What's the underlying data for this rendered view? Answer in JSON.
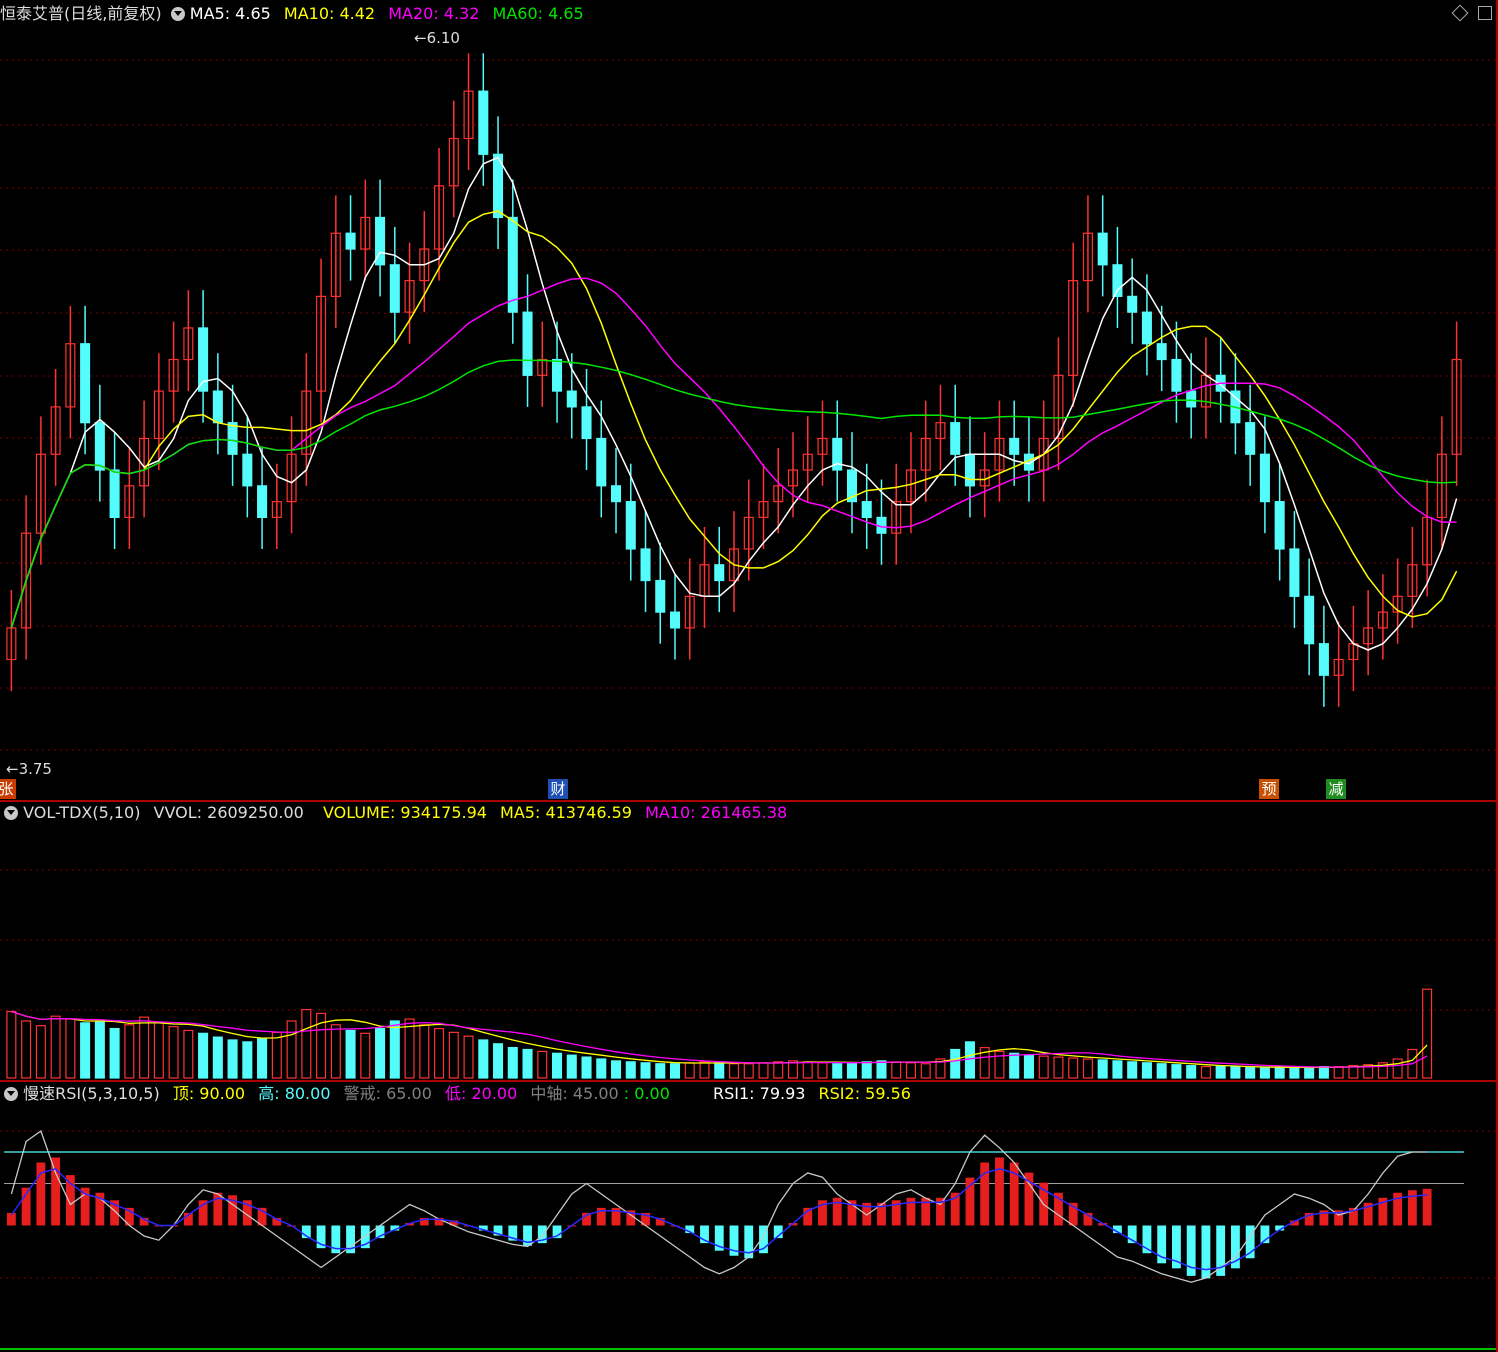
{
  "header_main": {
    "title": "恒泰艾普(日线,前复权)",
    "ma5": "MA5: 4.65",
    "ma10": "MA10: 4.42",
    "ma20": "MA20: 4.32",
    "ma60": "MA60: 4.65"
  },
  "price_labels": {
    "high": "6.10",
    "low": "3.75"
  },
  "markers": {
    "zhang": "张",
    "cai": "财",
    "yu": "预",
    "jian": "减"
  },
  "header_vol": {
    "name": "VOL-TDX(5,10)",
    "vvol": "VVOL: 2609250.00",
    "volume": "VOLUME: 934175.94",
    "ma5": "MA5: 413746.59",
    "ma10": "MA10: 261465.38"
  },
  "header_rsi": {
    "name": "慢速RSI(5,3,10,5)",
    "top": "顶: 90.00",
    "high": "高: 80.00",
    "warn": "警戒: 65.00",
    "low": "低: 20.00",
    "axis": "中轴: 45.00",
    "zero": ": 0.00",
    "rsi1": "RSI1: 79.93",
    "rsi2": "RSI2: 59.56"
  },
  "colors": {
    "up": "#ff3232",
    "down": "#54fcfc",
    "ma5": "#ffffff",
    "ma10": "#ffff00",
    "ma20": "#ff00ff",
    "ma60": "#00e600",
    "grid": "#7a0000",
    "frame": "#aa0000"
  },
  "chart_data": {
    "type": "candlestick",
    "price_range": [
      3.75,
      6.1
    ],
    "closes": [
      4.2,
      4.5,
      4.75,
      4.9,
      5.1,
      4.85,
      4.7,
      4.55,
      4.65,
      4.8,
      4.95,
      5.05,
      5.15,
      4.95,
      4.85,
      4.75,
      4.65,
      4.55,
      4.6,
      4.75,
      4.95,
      5.25,
      5.45,
      5.4,
      5.5,
      5.35,
      5.2,
      5.3,
      5.4,
      5.6,
      5.75,
      5.9,
      5.7,
      5.5,
      5.2,
      5.0,
      5.05,
      4.95,
      4.9,
      4.8,
      4.65,
      4.6,
      4.45,
      4.35,
      4.25,
      4.2,
      4.3,
      4.4,
      4.35,
      4.45,
      4.55,
      4.6,
      4.65,
      4.7,
      4.75,
      4.8,
      4.7,
      4.6,
      4.55,
      4.5,
      4.6,
      4.7,
      4.8,
      4.85,
      4.75,
      4.65,
      4.7,
      4.8,
      4.75,
      4.7,
      4.8,
      5.0,
      5.3,
      5.45,
      5.35,
      5.25,
      5.2,
      5.1,
      5.05,
      4.95,
      4.9,
      5.0,
      4.95,
      4.85,
      4.75,
      4.6,
      4.45,
      4.3,
      4.15,
      4.05,
      4.1,
      4.15,
      4.2,
      4.25,
      4.3,
      4.4,
      4.55,
      4.75,
      5.05
    ],
    "volume_range": [
      0,
      2609250
    ],
    "volumes": [
      700000,
      600000,
      550000,
      650000,
      620000,
      580000,
      600000,
      520000,
      560000,
      640000,
      580000,
      540000,
      500000,
      470000,
      430000,
      400000,
      380000,
      420000,
      480000,
      600000,
      720000,
      680000,
      560000,
      500000,
      470000,
      520000,
      600000,
      620000,
      560000,
      520000,
      480000,
      440000,
      400000,
      360000,
      320000,
      300000,
      280000,
      260000,
      240000,
      220000,
      200000,
      180000,
      170000,
      160000,
      150000,
      150000,
      160000,
      170000,
      160000,
      150000,
      150000,
      160000,
      170000,
      180000,
      170000,
      160000,
      150000,
      160000,
      170000,
      180000,
      170000,
      160000,
      150000,
      200000,
      300000,
      380000,
      320000,
      280000,
      260000,
      240000,
      230000,
      220000,
      210000,
      200000,
      190000,
      180000,
      170000,
      160000,
      150000,
      140000,
      130000,
      120000,
      120000,
      120000,
      110000,
      110000,
      110000,
      110000,
      110000,
      120000,
      120000,
      130000,
      140000,
      160000,
      200000,
      300000,
      934176
    ],
    "rsi_range": [
      0,
      100
    ],
    "rsi_levels": {
      "top": 90.0,
      "high": 80.0,
      "warn": 65.0,
      "low": 20.0,
      "axis": 45.0,
      "zero": 0.0
    },
    "rsi1": [
      60,
      85,
      90,
      70,
      55,
      60,
      58,
      52,
      45,
      40,
      38,
      45,
      55,
      62,
      60,
      55,
      50,
      45,
      40,
      35,
      30,
      25,
      30,
      35,
      40,
      45,
      50,
      55,
      52,
      48,
      45,
      42,
      40,
      38,
      36,
      35,
      40,
      50,
      60,
      65,
      60,
      55,
      50,
      45,
      40,
      35,
      30,
      25,
      22,
      25,
      30,
      40,
      55,
      65,
      70,
      68,
      60,
      55,
      50,
      55,
      60,
      62,
      58,
      55,
      65,
      80,
      88,
      82,
      75,
      65,
      55,
      50,
      45,
      40,
      35,
      30,
      28,
      25,
      22,
      20,
      18,
      20,
      25,
      30,
      40,
      50,
      55,
      60,
      58,
      55,
      50,
      52,
      60,
      70,
      78,
      80,
      80
    ],
    "rsi2": [
      50,
      60,
      70,
      72,
      65,
      60,
      58,
      55,
      52,
      48,
      45,
      45,
      50,
      55,
      58,
      57,
      55,
      52,
      48,
      45,
      40,
      36,
      34,
      34,
      36,
      40,
      43,
      46,
      48,
      48,
      47,
      45,
      43,
      41,
      39,
      37,
      38,
      40,
      45,
      50,
      52,
      52,
      51,
      50,
      48,
      45,
      42,
      38,
      35,
      33,
      32,
      34,
      40,
      46,
      52,
      55,
      56,
      55,
      54,
      54,
      55,
      56,
      56,
      56,
      58,
      64,
      70,
      72,
      70,
      66,
      62,
      58,
      54,
      50,
      46,
      42,
      38,
      34,
      30,
      28,
      25,
      24,
      25,
      28,
      32,
      38,
      43,
      47,
      50,
      51,
      51,
      52,
      54,
      56,
      58,
      59,
      59.56
    ]
  }
}
